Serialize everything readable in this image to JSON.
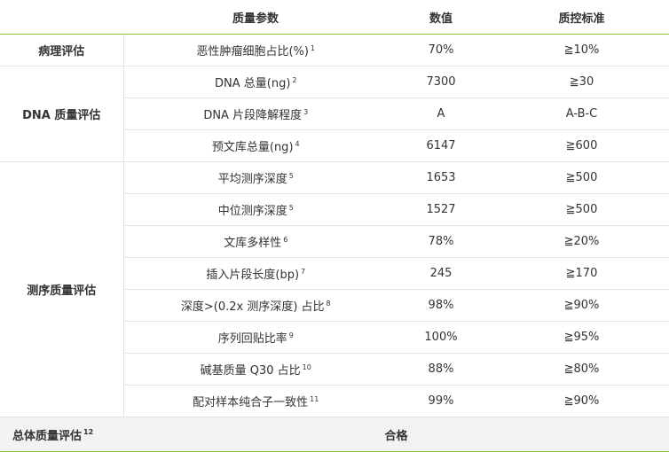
{
  "header": {
    "param": "质量参数",
    "value": "数值",
    "standard": "质控标准"
  },
  "groups": [
    {
      "label": "病理评估",
      "rows": [
        {
          "param": "恶性肿瘤细胞占比(%)",
          "note": "1",
          "value": "70%",
          "standard": "≧10%"
        }
      ]
    },
    {
      "label": "DNA 质量评估",
      "rows": [
        {
          "param": "DNA 总量(ng)",
          "note": "2",
          "value": "7300",
          "standard": "≧30"
        },
        {
          "param": "DNA 片段降解程度",
          "note": "3",
          "value": "A",
          "standard": "A-B-C"
        },
        {
          "param": "预文库总量(ng)",
          "note": "4",
          "value": "6147",
          "standard": "≧600"
        }
      ]
    },
    {
      "label": "测序质量评估",
      "rows": [
        {
          "param": "平均测序深度",
          "note": "5",
          "value": "1653",
          "standard": "≧500"
        },
        {
          "param": "中位测序深度",
          "note": "5",
          "value": "1527",
          "standard": "≧500"
        },
        {
          "param": "文库多样性",
          "note": "6",
          "value": "78%",
          "standard": "≧20%"
        },
        {
          "param": "插入片段长度(bp)",
          "note": "7",
          "value": "245",
          "standard": "≧170"
        },
        {
          "param": "深度>(0.2x 测序深度) 占比",
          "note": "8",
          "value": "98%",
          "standard": "≧90%"
        },
        {
          "param": "序列回贴比率",
          "note": "9",
          "value": "100%",
          "standard": "≧95%"
        },
        {
          "param": "碱基质量 Q30 占比",
          "note": "10",
          "value": "88%",
          "standard": "≧80%"
        },
        {
          "param": "配对样本纯合子一致性",
          "note": "11",
          "value": "99%",
          "standard": "≧90%"
        }
      ]
    }
  ],
  "overall": {
    "label": "总体质量评估",
    "note": "12",
    "result": "合格"
  },
  "colors": {
    "accent_line": "#8cc63e",
    "grid_line": "#e3e3e3",
    "footer_bg": "#f2f2f2"
  }
}
